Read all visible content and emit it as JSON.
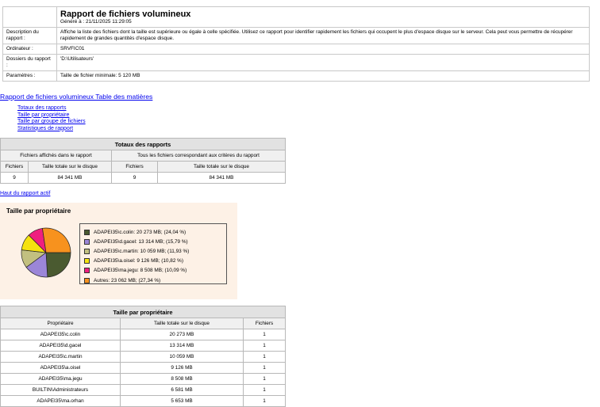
{
  "report": {
    "title": "Rapport de fichiers volumineux",
    "generated": "Généré à : 21/11/2025 11:29:05",
    "rows": [
      {
        "label": "Description du rapport :",
        "value": "Affiche la liste des fichiers dont la taille est supérieure ou égale à celle spécifiée. Utilisez ce rapport pour identifier rapidement les fichiers qui occupent le plus d'espace disque sur le serveur. Cela peut vous permettre de récupérer rapidement de grandes quantités d'espace disque."
      },
      {
        "label": "Ordinateur :",
        "value": "SRVFIC01"
      },
      {
        "label": "Dossiers du rapport :",
        "value": "'D:\\Utilisateurs'"
      },
      {
        "label": "Paramètres :",
        "value": "Taille de fichier minimale: 5 120 MB"
      }
    ]
  },
  "toc": {
    "title": "Rapport de fichiers volumineux Table des matières",
    "links": [
      "Totaux des rapports",
      "Taille par propriétaire",
      "Taille par groupe de fichiers",
      "Statistiques de rapport"
    ]
  },
  "totaux": {
    "title": "Totaux des rapports",
    "group1": "Fichiers affichés dans le rapport",
    "group2": "Tous les fichiers correspondant aux critères du rapport",
    "col_files": "Fichiers",
    "col_size": "Taille totale sur le disque",
    "values": [
      "9",
      "84 341 MB",
      "9",
      "84 341 MB"
    ]
  },
  "top_link": "Haut du rapport actif",
  "chart_title": "Taille par propriétaire",
  "chart_data": {
    "type": "pie",
    "title": "Taille par propriétaire",
    "slices": [
      {
        "label": "ADAPEI35\\c.colin: 20 273 MB; (24,04 %)",
        "value": 24.04,
        "color": "#4a5a30"
      },
      {
        "label": "ADAPEI35\\d.gacel: 13 314 MB; (15,79 %)",
        "value": 15.79,
        "color": "#9b86d8"
      },
      {
        "label": "ADAPEI35\\c.martin: 10 059 MB; (11,93 %)",
        "value": 11.93,
        "color": "#c2c080"
      },
      {
        "label": "ADAPEI35\\a.oisel: 9 126 MB; (10,82 %)",
        "value": 10.82,
        "color": "#f5e20f"
      },
      {
        "label": "ADAPEI35\\ma.jegu: 8 508 MB; (10,09 %)",
        "value": 10.09,
        "color": "#ef1f7f"
      },
      {
        "label": "Autres: 23 062 MB; (27,34 %)",
        "value": 27.34,
        "color": "#f7921e"
      }
    ],
    "legend": "right"
  },
  "owners": {
    "title": "Taille par propriétaire",
    "headers": [
      "Propriétaire",
      "Taille totale sur le disque",
      "Fichiers"
    ],
    "rows": [
      [
        "ADAPEI35\\c.colin",
        "20 273 MB",
        "1"
      ],
      [
        "ADAPEI35\\d.gacel",
        "13 314 MB",
        "1"
      ],
      [
        "ADAPEI35\\c.martin",
        "10 059 MB",
        "1"
      ],
      [
        "ADAPEI35\\a.oisel",
        "9 126 MB",
        "1"
      ],
      [
        "ADAPEI35\\ma.jegu",
        "8 508 MB",
        "1"
      ],
      [
        "BUILTIN\\Administrateurs",
        "6 581 MB",
        "1"
      ],
      [
        "ADAPEI35\\ma.orhan",
        "5 653 MB",
        "1"
      ]
    ]
  }
}
